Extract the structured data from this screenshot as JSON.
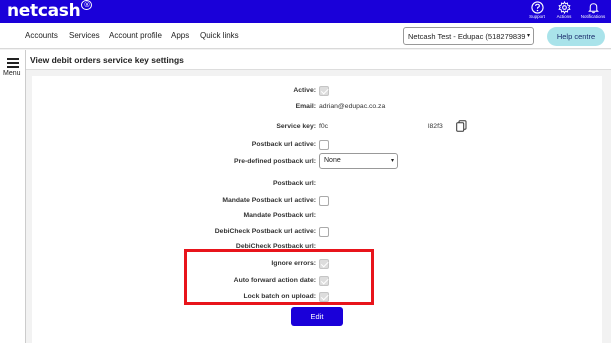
{
  "brand": {
    "logo_text": "netcash",
    "logo_mark": "®"
  },
  "topbar": {
    "actions": [
      {
        "icon": "question-icon",
        "label": "Support"
      },
      {
        "icon": "gear-icon",
        "label": "Actions"
      },
      {
        "icon": "bell-icon",
        "label": "Notifications"
      }
    ]
  },
  "nav": {
    "items": [
      "Accounts",
      "Services",
      "Account profile",
      "Apps",
      "Quick links"
    ],
    "entity_select": "Netcash Test - Edupac (518279839",
    "help_label": "Help centre"
  },
  "sidebar": {
    "menu_label": "Menu"
  },
  "page": {
    "title": "View debit orders service key settings"
  },
  "form": {
    "active_label": "Active:",
    "email_label": "Email:",
    "email_value": "adrian@edupac.co.za",
    "service_key_label": "Service key:",
    "service_key_start": "f0c",
    "service_key_end": "l82f3",
    "postback_active_label": "Postback url active:",
    "predefined_label": "Pre-defined postback url:",
    "predefined_value": "None",
    "postback_url_label": "Postback url:",
    "mandate_active_label": "Mandate Postback url active:",
    "mandate_url_label": "Mandate Postback url:",
    "debicheck_active_label": "DebiCheck Postback url active:",
    "debicheck_url_label": "DebiCheck Postback url:",
    "ignore_errors_label": "Ignore errors:",
    "auto_forward_label": "Auto forward action date:",
    "lock_batch_label": "Lock batch on upload:",
    "edit_label": "Edit"
  },
  "colors": {
    "brand_blue": "#1a00d9",
    "help_cyan": "#a9e3ea",
    "highlight_red": "#e8141b"
  }
}
